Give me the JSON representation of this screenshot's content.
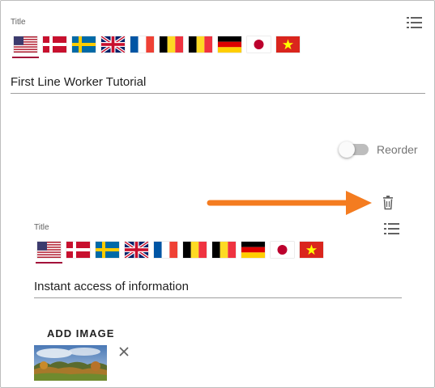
{
  "section1": {
    "title_label": "Title",
    "value": "First Line Worker Tutorial"
  },
  "toggle": {
    "label": "Reorder",
    "on": false
  },
  "section2": {
    "title_label": "Title",
    "value": "Instant access of information",
    "add_image_label": "ADD IMAGE"
  },
  "flags": [
    "us",
    "dk",
    "se",
    "gb",
    "fr",
    "be",
    "be",
    "de",
    "jp",
    "vn"
  ],
  "icons": {
    "list": "list-icon",
    "trash": "trash-icon",
    "close": "close-icon",
    "arrow": "arrow-annotation"
  },
  "colors": {
    "accent_underline": "#a3123a",
    "annotation_arrow": "#f47c20"
  }
}
